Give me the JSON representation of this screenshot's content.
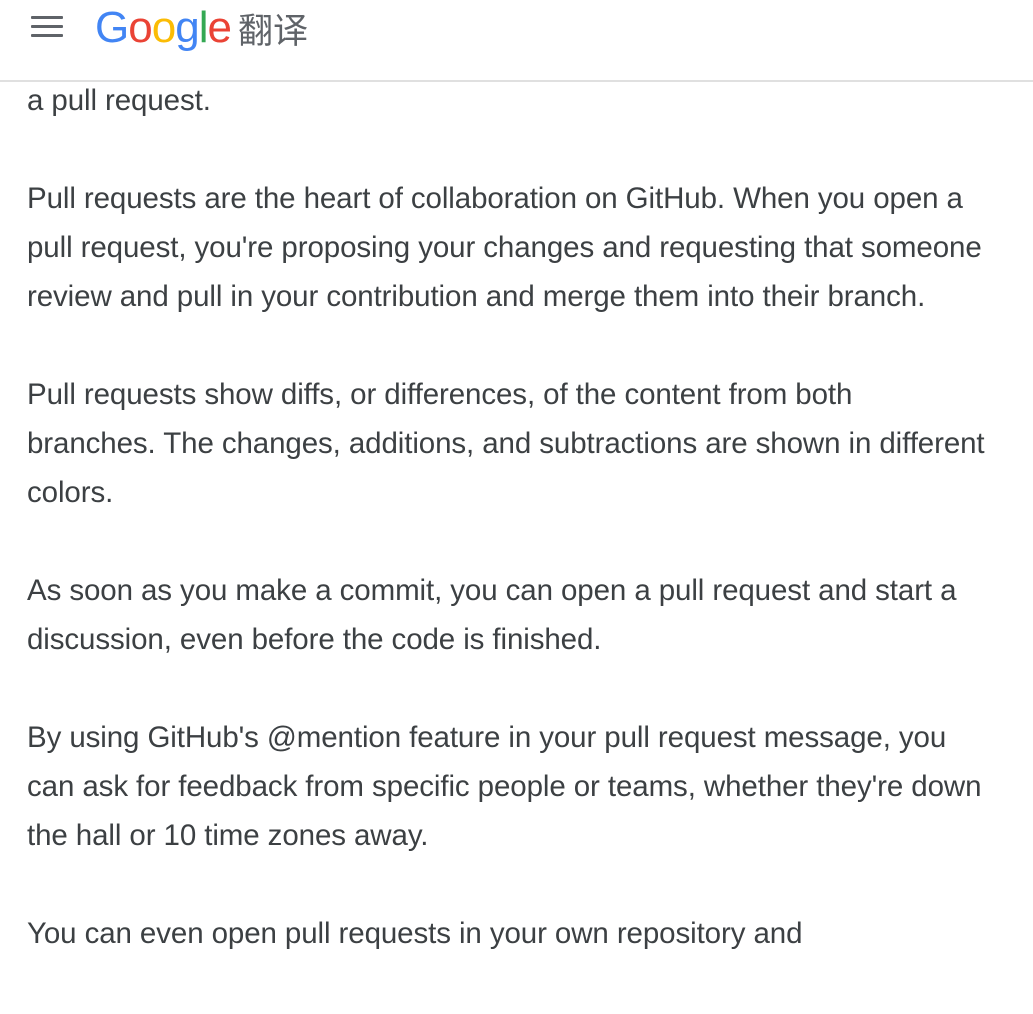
{
  "header": {
    "logo_letters": [
      {
        "char": "G",
        "color": "#4285F4"
      },
      {
        "char": "o",
        "color": "#EA4335"
      },
      {
        "char": "o",
        "color": "#FBBC05"
      },
      {
        "char": "g",
        "color": "#4285F4"
      },
      {
        "char": "l",
        "color": "#34A853"
      },
      {
        "char": "e",
        "color": "#EA4335"
      }
    ],
    "logo_suffix": "翻译",
    "menu_icon": "hamburger-menu-icon"
  },
  "content": {
    "paragraphs": [
      "a pull request.",
      "Pull requests are the heart of collaboration on GitHub. When you open a pull request, you're proposing your changes and requesting that someone review and pull in your contribution and merge them into their branch.",
      "Pull requests show diffs, or differences, of the content from both branches. The changes, additions, and subtractions are shown in different colors.",
      "As soon as you make a commit, you can open a pull request and start a discussion, even before the code is finished.",
      "By using GitHub's @mention feature in your pull request message, you can ask for feedback from specific people or teams, whether they're down the hall or 10 time zones away.",
      "You can even open pull requests in your own repository and"
    ]
  }
}
